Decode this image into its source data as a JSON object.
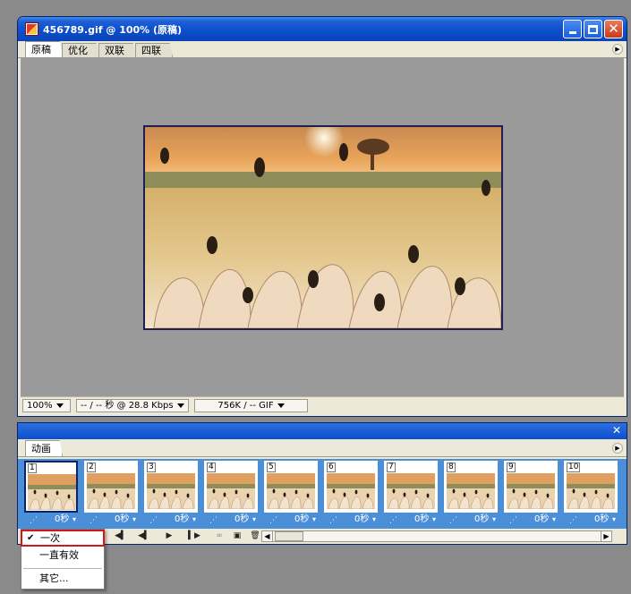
{
  "window": {
    "title": "456789.gif @ 100% (原稿)",
    "tabs": [
      "原稿",
      "优化",
      "双联",
      "四联"
    ],
    "active_tab": 0
  },
  "status": {
    "zoom": "100%",
    "timing": "-- / -- 秒 @ 28.8 Kbps",
    "size": "756K / -- GIF"
  },
  "animation": {
    "tab_label": "动画",
    "frames": [
      {
        "num": "1",
        "delay": "0秒"
      },
      {
        "num": "2",
        "delay": "0秒"
      },
      {
        "num": "3",
        "delay": "0秒"
      },
      {
        "num": "4",
        "delay": "0秒"
      },
      {
        "num": "5",
        "delay": "0秒"
      },
      {
        "num": "6",
        "delay": "0秒"
      },
      {
        "num": "7",
        "delay": "0秒"
      },
      {
        "num": "8",
        "delay": "0秒"
      },
      {
        "num": "9",
        "delay": "0秒"
      },
      {
        "num": "10",
        "delay": "0秒"
      }
    ],
    "selected_frame": 0
  },
  "loop_menu": {
    "items": [
      "一次",
      "一直有效",
      "其它..."
    ],
    "checked": 0
  },
  "colors": {
    "titlebar": "#0c4fcc",
    "frames_bg": "#4c8fd9",
    "highlight": "#d01818"
  }
}
